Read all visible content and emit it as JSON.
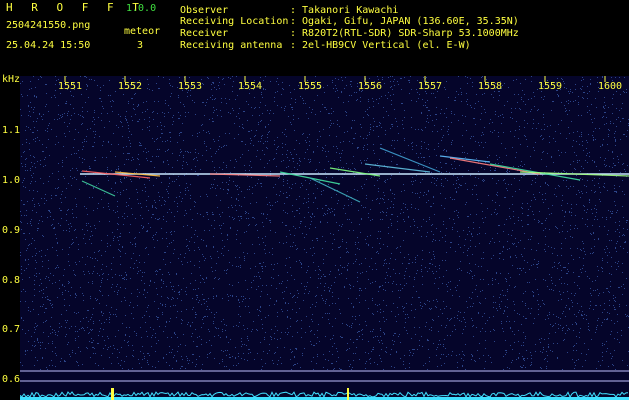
{
  "header": {
    "app_title": "H R O F F T",
    "version": "1.0.0",
    "filename": "2504241550.png",
    "datetime": "25.04.24 15:50",
    "meteor_label": "meteor",
    "meteor_count": "3",
    "info": [
      {
        "label": "Observer",
        "value": ": Takanori Kawachi"
      },
      {
        "label": "Receiving Location",
        "value": ": Ogaki, Gifu, JAPAN (136.60E, 35.35N)"
      },
      {
        "label": "Receiver",
        "value": ": R820T2(RTL-SDR) SDR-Sharp 53.1000MHz"
      },
      {
        "label": "Receiving antenna",
        "value": ": 2el-HB9CV Vertical (el. E-W)"
      }
    ]
  },
  "axes": {
    "y_unit": "kHz",
    "y_ticks": [
      "1.1",
      "1.0",
      "0.9",
      "0.8",
      "0.7",
      "0.6"
    ],
    "x_ticks": [
      "1551",
      "1552",
      "1553",
      "1554",
      "1555",
      "1556",
      "1557",
      "1558",
      "1559",
      "1600"
    ]
  },
  "colors": {
    "background": "#05052a",
    "noise": "#3a5aa8",
    "carrier": "#c8e8ff",
    "label": "#ffff40",
    "header_green": "#40e040"
  }
}
